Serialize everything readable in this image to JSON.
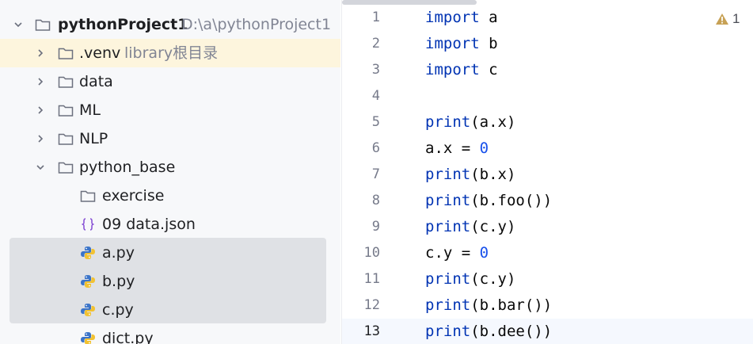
{
  "project": {
    "name": "pythonProject1",
    "path": "D:\\a\\pythonProject1",
    "items": [
      {
        "label": "pythonProject1",
        "hint": "D:\\a\\pythonProject1"
      },
      {
        "label": ".venv",
        "hint": "library根目录"
      },
      {
        "label": "data"
      },
      {
        "label": "ML"
      },
      {
        "label": "NLP"
      },
      {
        "label": "python_base"
      },
      {
        "label": "exercise"
      },
      {
        "label": "09 data.json"
      },
      {
        "label": "a.py"
      },
      {
        "label": "b.py"
      },
      {
        "label": "c.py"
      },
      {
        "label": "dict.py"
      }
    ]
  },
  "editor": {
    "warning_count": "1",
    "lines": [
      {
        "n": "1",
        "tokens": [
          {
            "t": "import",
            "k": "kw"
          },
          {
            "t": " a"
          }
        ]
      },
      {
        "n": "2",
        "tokens": [
          {
            "t": "import",
            "k": "kw"
          },
          {
            "t": " b"
          }
        ]
      },
      {
        "n": "3",
        "tokens": [
          {
            "t": "import",
            "k": "kw"
          },
          {
            "t": " c"
          }
        ]
      },
      {
        "n": "4",
        "tokens": []
      },
      {
        "n": "5",
        "tokens": [
          {
            "t": "print",
            "k": "kw"
          },
          {
            "t": "(a.x)"
          }
        ]
      },
      {
        "n": "6",
        "tokens": [
          {
            "t": "a.x = "
          },
          {
            "t": "0",
            "k": "num"
          }
        ]
      },
      {
        "n": "7",
        "tokens": [
          {
            "t": "print",
            "k": "kw"
          },
          {
            "t": "(b.x)"
          }
        ]
      },
      {
        "n": "8",
        "tokens": [
          {
            "t": "print",
            "k": "kw"
          },
          {
            "t": "(b.foo())"
          }
        ]
      },
      {
        "n": "9",
        "tokens": [
          {
            "t": "print",
            "k": "kw"
          },
          {
            "t": "(c.y)"
          }
        ]
      },
      {
        "n": "10",
        "tokens": [
          {
            "t": "c.y = "
          },
          {
            "t": "0",
            "k": "num"
          }
        ]
      },
      {
        "n": "11",
        "tokens": [
          {
            "t": "print",
            "k": "kw"
          },
          {
            "t": "(c.y)"
          }
        ]
      },
      {
        "n": "12",
        "tokens": [
          {
            "t": "print",
            "k": "kw"
          },
          {
            "t": "(b.bar())"
          }
        ]
      },
      {
        "n": "13",
        "tokens": [
          {
            "t": "print",
            "k": "kw"
          },
          {
            "t": "(b.dee())"
          }
        ]
      }
    ]
  }
}
